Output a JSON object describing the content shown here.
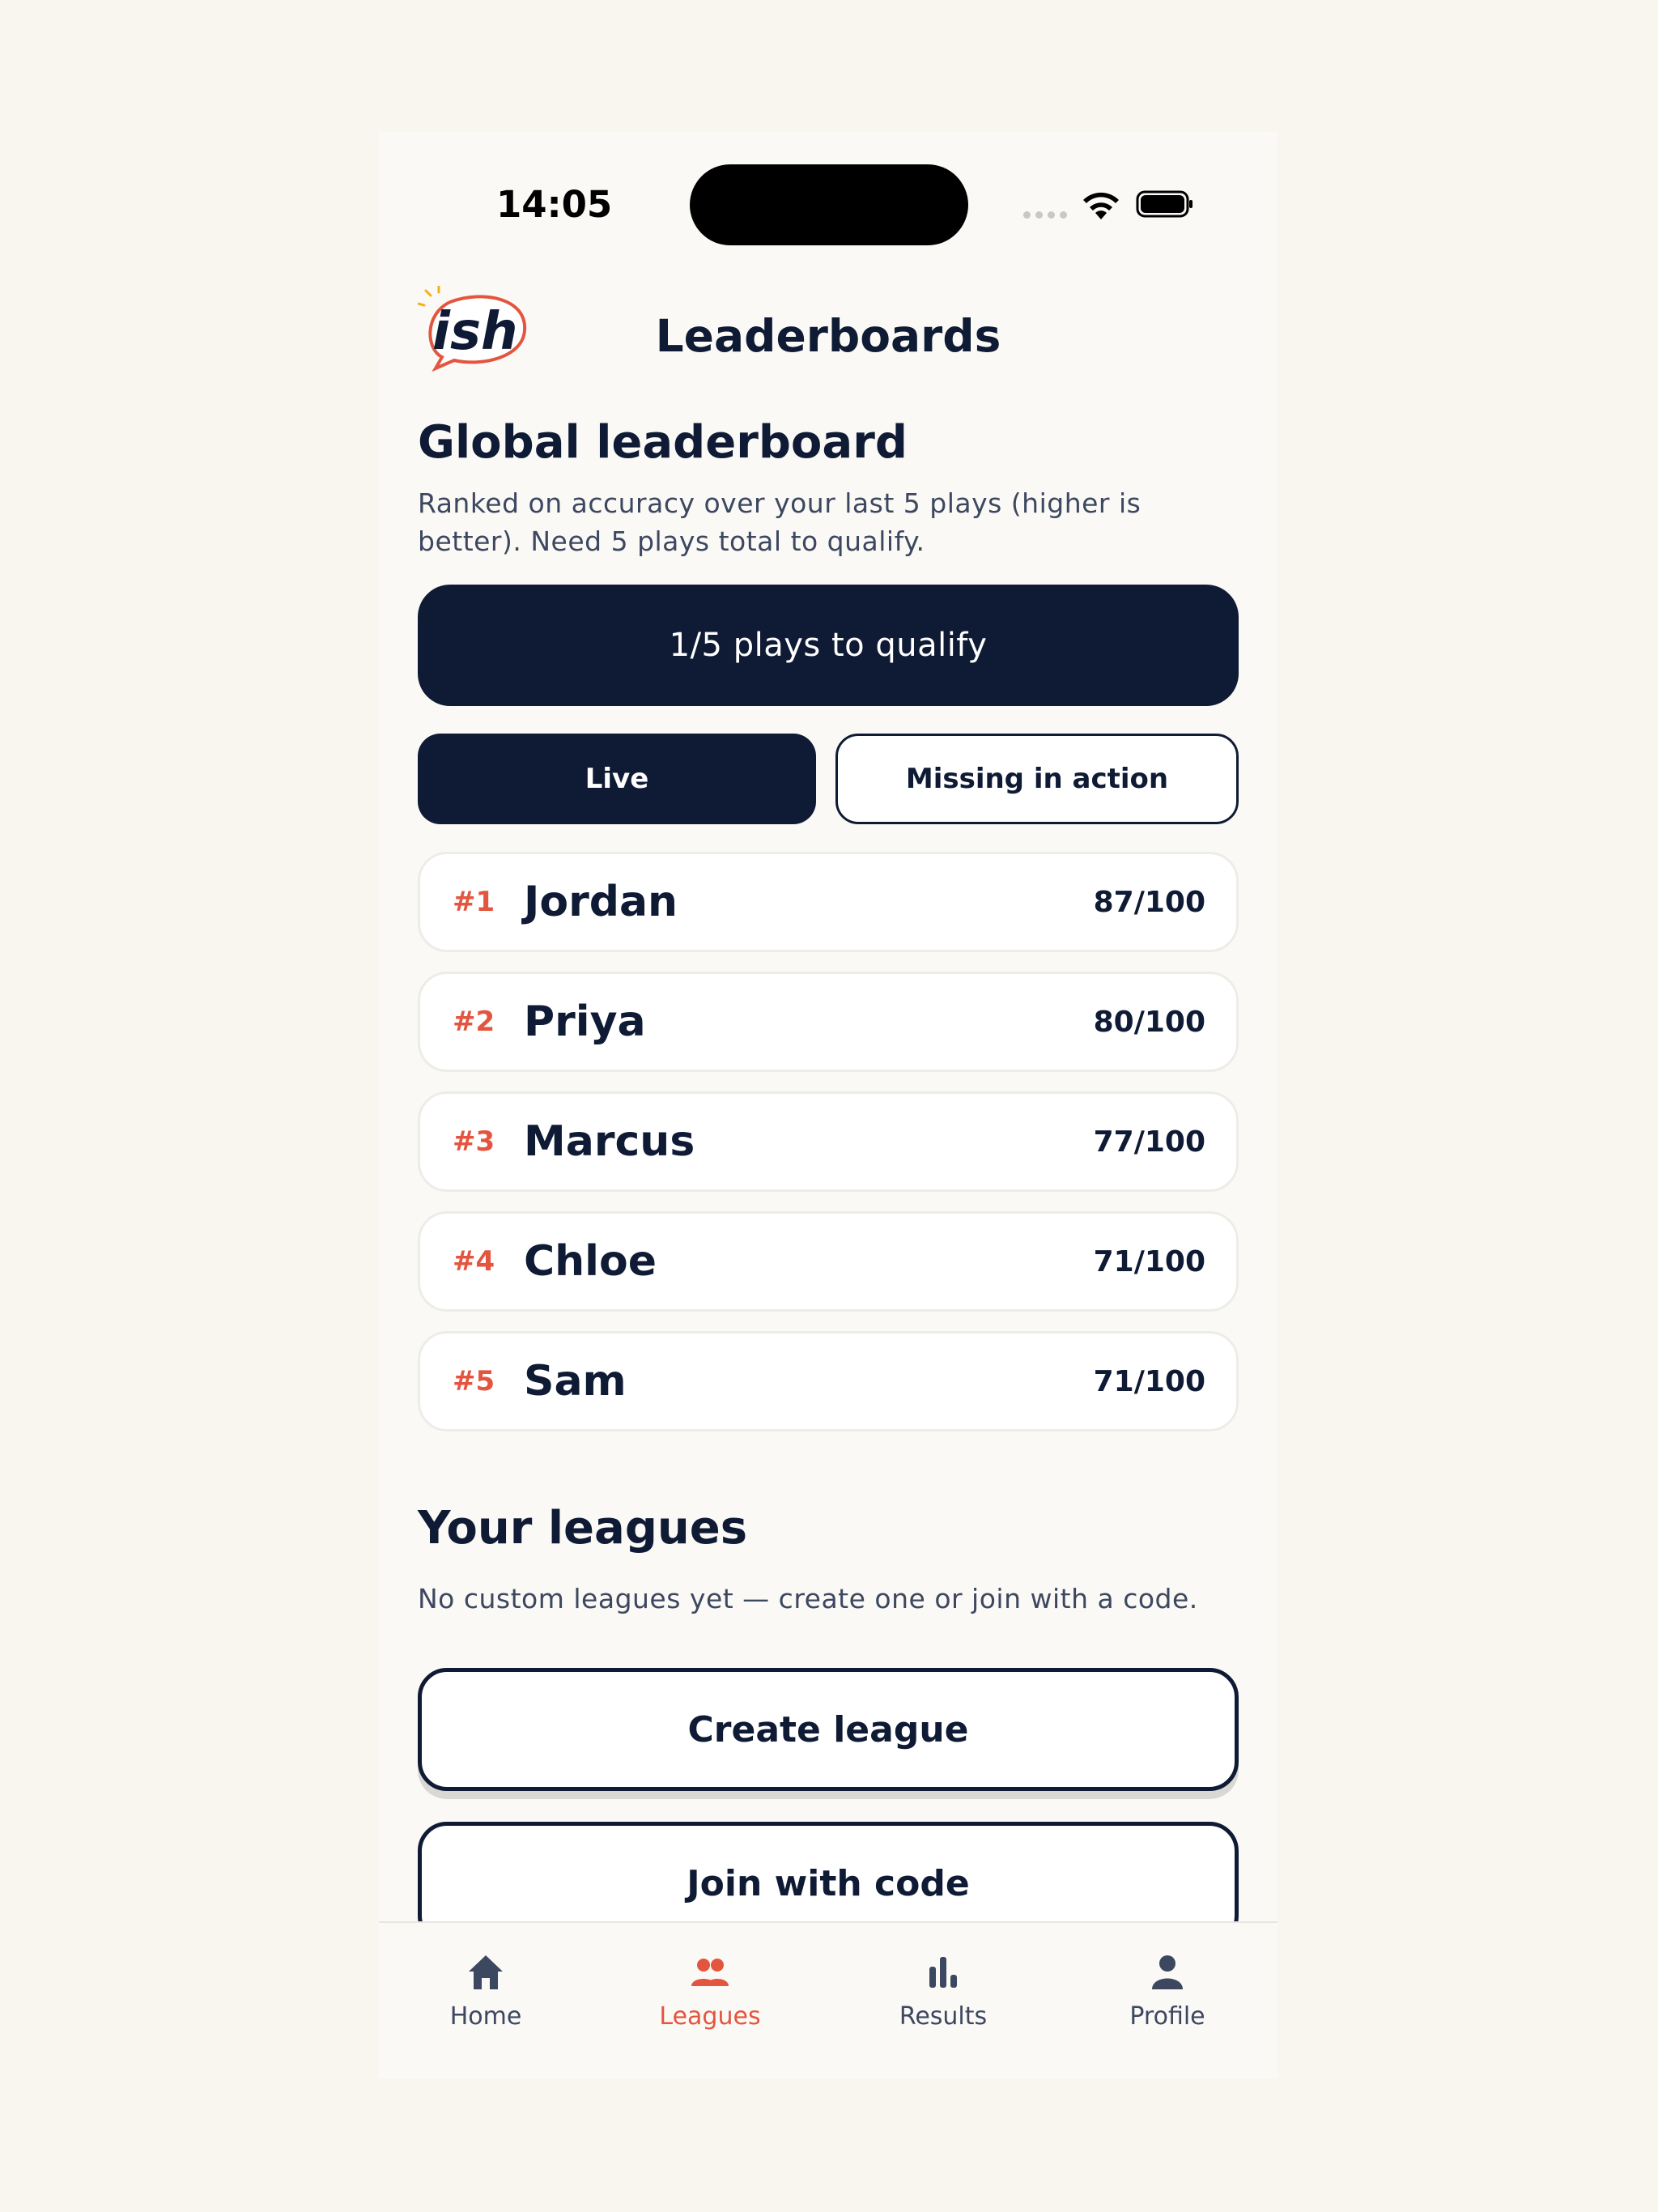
{
  "status_bar": {
    "time": "14:05"
  },
  "header": {
    "logo_text": "ish",
    "title": "Leaderboards"
  },
  "global": {
    "title": "Global leaderboard",
    "description": "Ranked on accuracy over your last 5 plays (higher is better). Need 5 plays total to qualify.",
    "qualify_banner": "1/5 plays to qualify",
    "tabs": [
      {
        "label": "Live",
        "active": true
      },
      {
        "label": "Missing in action",
        "active": false
      }
    ],
    "rows": [
      {
        "rank": "#1",
        "name": "Jordan",
        "score": "87/100"
      },
      {
        "rank": "#2",
        "name": "Priya",
        "score": "80/100"
      },
      {
        "rank": "#3",
        "name": "Marcus",
        "score": "77/100"
      },
      {
        "rank": "#4",
        "name": "Chloe",
        "score": "71/100"
      },
      {
        "rank": "#5",
        "name": "Sam",
        "score": "71/100"
      }
    ]
  },
  "leagues": {
    "title": "Your leagues",
    "description": "No custom leagues yet — create one or join with a code.",
    "create_label": "Create league",
    "join_label": "Join with code"
  },
  "tabbar": {
    "items": [
      {
        "label": "Home",
        "icon": "home-icon",
        "active": false
      },
      {
        "label": "Leagues",
        "icon": "people-icon",
        "active": true
      },
      {
        "label": "Results",
        "icon": "bar-chart-icon",
        "active": false
      },
      {
        "label": "Profile",
        "icon": "person-icon",
        "active": false
      }
    ]
  },
  "colors": {
    "navy": "#0f1b35",
    "accent": "#e4553f",
    "background": "#f9f6f0"
  }
}
